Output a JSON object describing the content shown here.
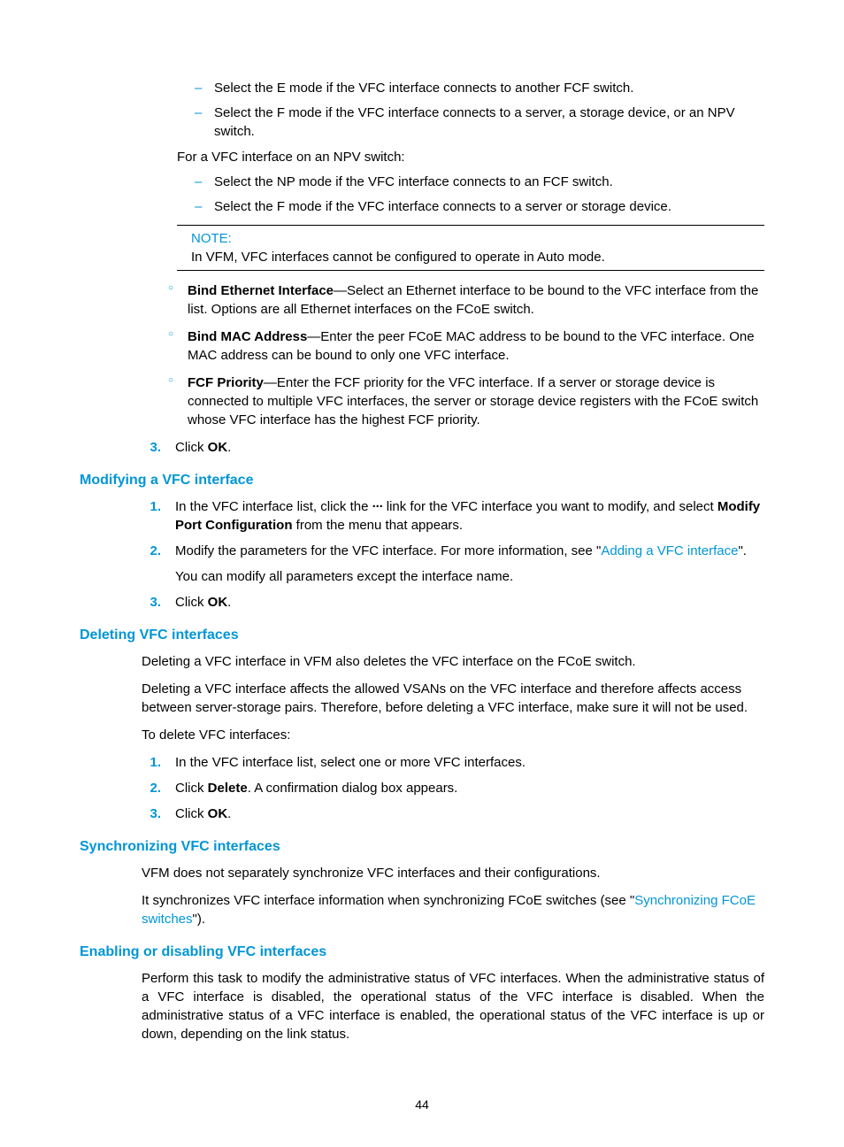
{
  "top_dash": {
    "items": [
      "Select the E mode if the VFC interface connects to another FCF switch.",
      "Select the F mode if the VFC interface connects to a server, a storage device, or an NPV switch."
    ]
  },
  "npv_intro": "For a VFC interface on an NPV switch:",
  "npv_dash": {
    "items": [
      "Select the NP mode if the VFC interface connects to an FCF switch.",
      "Select the F mode if the VFC interface connects to a server or storage device."
    ]
  },
  "note": {
    "title": "NOTE:",
    "body": "In VFM, VFC interfaces cannot be configured to operate in Auto mode."
  },
  "circ": {
    "items": [
      {
        "bold": "Bind Ethernet Interface",
        "rest": "—Select an Ethernet interface to be bound to the VFC interface from the list. Options are all Ethernet interfaces on the FCoE switch."
      },
      {
        "bold": "Bind MAC Address",
        "rest": "—Enter the peer FCoE MAC address to be bound to the VFC interface. One MAC address can be bound to only one VFC interface."
      },
      {
        "bold": "FCF Priority",
        "rest": "—Enter the FCF priority for the VFC interface. If a server or storage device is connected to multiple VFC interfaces, the server or storage device registers with the FCoE switch whose VFC interface has the highest FCF priority."
      }
    ]
  },
  "step3": {
    "num": "3.",
    "pre": "Click ",
    "bold": "OK",
    "post": "."
  },
  "modify": {
    "heading": "Modifying a VFC interface",
    "s1_num": "1.",
    "s1_a": "In the VFC interface list, click the ",
    "s1_b": " link for the VFC interface you want to modify, and select ",
    "s1_bold": "Modify Port Configuration",
    "s1_c": " from the menu that appears.",
    "s2_num": "2.",
    "s2_a": "Modify the parameters for the VFC interface. For more information, see \"",
    "s2_link": "Adding a VFC interface",
    "s2_b": "\".",
    "s2_extra": "You can modify all parameters except the interface name.",
    "s3_num": "3.",
    "s3_pre": "Click ",
    "s3_bold": "OK",
    "s3_post": "."
  },
  "delete": {
    "heading": "Deleting VFC interfaces",
    "p1": "Deleting a VFC interface in VFM also deletes the VFC interface on the FCoE switch.",
    "p2": "Deleting a VFC interface affects the allowed VSANs on the VFC interface and therefore affects access between server-storage pairs. Therefore, before deleting a VFC interface, make sure it will not be used.",
    "p3": "To delete VFC interfaces:",
    "s1_num": "1.",
    "s1": "In the VFC interface list, select one or more VFC interfaces.",
    "s2_num": "2.",
    "s2_pre": "Click ",
    "s2_bold": "Delete",
    "s2_post": ". A confirmation dialog box appears.",
    "s3_num": "3.",
    "s3_pre": "Click ",
    "s3_bold": "OK",
    "s3_post": "."
  },
  "sync": {
    "heading": "Synchronizing VFC interfaces",
    "p1": "VFM does not separately synchronize VFC interfaces and their configurations.",
    "p2_a": "It synchronizes VFC interface information when synchronizing FCoE switches (see \"",
    "p2_link": "Synchronizing FCoE switches",
    "p2_b": "\")."
  },
  "enable": {
    "heading": "Enabling or disabling VFC interfaces",
    "p1": "Perform this task to modify the administrative status of VFC interfaces. When the administrative status of a VFC interface is disabled, the operational status of the VFC interface is disabled. When the administrative status of a VFC interface is enabled, the operational status of the VFC interface is up or down, depending on the link status."
  },
  "pageno": "44",
  "dots": "···"
}
